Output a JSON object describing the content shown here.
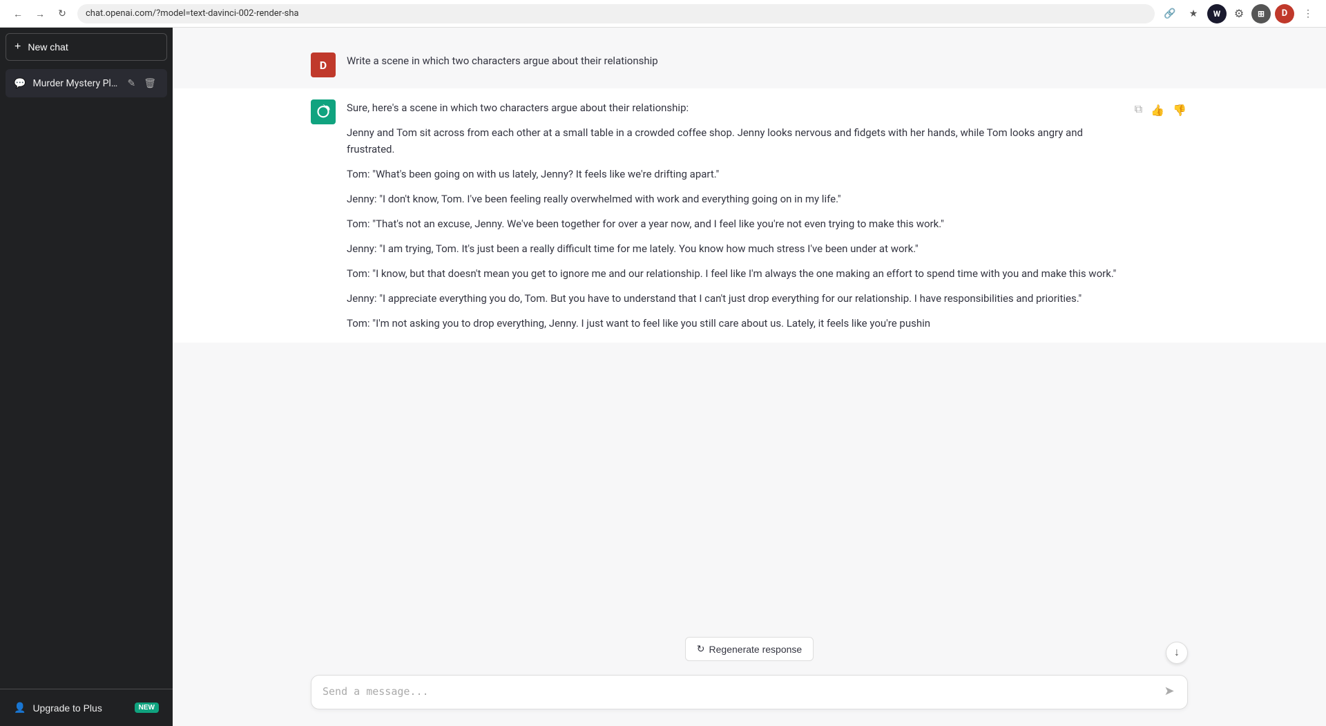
{
  "browser": {
    "url": "chat.openai.com/?model=text-davinci-002-render-sha",
    "back_btn": "←",
    "forward_btn": "→",
    "refresh_btn": "↻"
  },
  "sidebar": {
    "new_chat_label": "New chat",
    "chats": [
      {
        "label": "Murder Mystery Plot."
      }
    ],
    "upgrade_label": "Upgrade to Plus",
    "upgrade_badge": "NEW"
  },
  "conversation": {
    "user_message": "Write a scene in which two characters argue about their relationship",
    "assistant_response": {
      "intro": "Sure, here's a scene in which two characters argue about their relationship:",
      "paragraphs": [
        "Jenny and Tom sit across from each other at a small table in a crowded coffee shop. Jenny looks nervous and fidgets with her hands, while Tom looks angry and frustrated.",
        "Tom: \"What's been going on with us lately, Jenny? It feels like we're drifting apart.\"",
        "Jenny: \"I don't know, Tom. I've been feeling really overwhelmed with work and everything going on in my life.\"",
        "Tom: \"That's not an excuse, Jenny. We've been together for over a year now, and I feel like you're not even trying to make this work.\"",
        "Jenny: \"I am trying, Tom. It's just been a really difficult time for me lately. You know how much stress I've been under at work.\"",
        "Tom: \"I know, but that doesn't mean you get to ignore me and our relationship. I feel like I'm always the one making an effort to spend time with you and make this work.\"",
        "Jenny: \"I appreciate everything you do, Tom. But you have to understand that I can't just drop everything for our relationship. I have responsibilities and priorities.\"",
        "Tom: \"I'm not asking you to drop everything, Jenny. I just want to feel like you still care about us. Lately, it feels like you're pushin"
      ]
    }
  },
  "input": {
    "placeholder": "Send a message...",
    "send_icon": "➤"
  },
  "regenerate_btn": "Regenerate response",
  "actions": {
    "copy": "⧉",
    "thumbs_up": "👍",
    "thumbs_down": "👎",
    "edit": "✏",
    "delete": "🗑",
    "scroll_down": "↓"
  }
}
